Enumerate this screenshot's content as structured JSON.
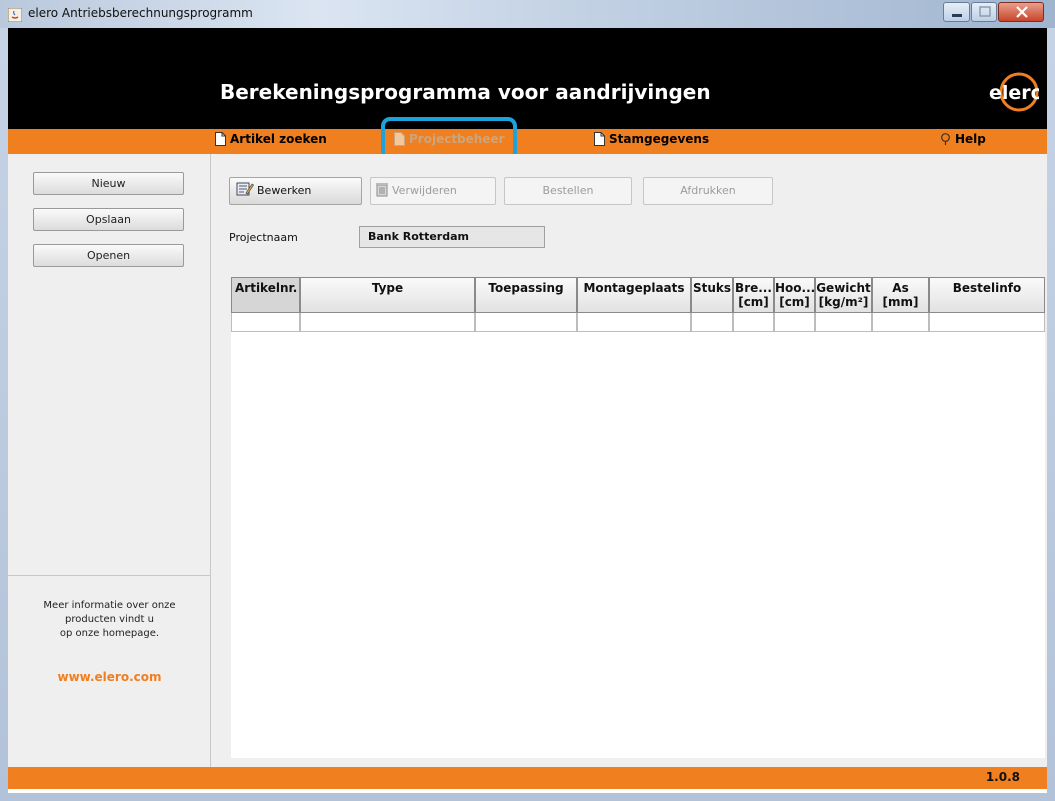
{
  "window": {
    "title": "elero Antriebsberechnungsprogramm"
  },
  "header": {
    "app_title": "Berekeningsprogramma voor aandrijvingen",
    "logo_text": "elero",
    "logo_color": "#f07f1f"
  },
  "nav": {
    "items": [
      {
        "label": "Artikel zoeken",
        "icon": "page-icon",
        "enabled": true
      },
      {
        "label": "Projectbeheer",
        "icon": "page-icon",
        "enabled": false,
        "highlighted": true
      },
      {
        "label": "Stamgegevens",
        "icon": "page-icon",
        "enabled": true
      },
      {
        "label": "Help",
        "icon": "help-icon",
        "enabled": true
      }
    ]
  },
  "sidebar": {
    "buttons": [
      "Nieuw",
      "Opslaan",
      "Openen"
    ],
    "info_lines": [
      "Meer informatie over onze",
      "producten vindt u",
      "op onze homepage."
    ],
    "website": "www.elero.com"
  },
  "toolbar": {
    "buttons": [
      {
        "label": "Bewerken",
        "icon": "edit-icon",
        "enabled": true
      },
      {
        "label": "Verwijderen",
        "icon": "delete-icon",
        "enabled": false
      },
      {
        "label": "Bestellen",
        "enabled": false
      },
      {
        "label": "Afdrukken",
        "enabled": false
      }
    ]
  },
  "project": {
    "label": "Projectnaam",
    "value": "Bank Rotterdam"
  },
  "table": {
    "columns": [
      {
        "line1": "Artikelnr.",
        "line2": ""
      },
      {
        "line1": "Type",
        "line2": ""
      },
      {
        "line1": "Toepassing",
        "line2": ""
      },
      {
        "line1": "Montageplaats",
        "line2": ""
      },
      {
        "line1": "Stuks",
        "line2": ""
      },
      {
        "line1": "Bre...",
        "line2": "[cm]"
      },
      {
        "line1": "Hoo...",
        "line2": "[cm]"
      },
      {
        "line1": "Gewicht",
        "line2": "[kg/m²]"
      },
      {
        "line1": "As",
        "line2": "[mm]"
      },
      {
        "line1": "Bestelinfo",
        "line2": ""
      }
    ],
    "rows": [
      [
        "",
        "",
        "",
        "",
        "",
        "",
        "",
        "",
        "",
        ""
      ]
    ]
  },
  "status": {
    "version": "1.0.8"
  },
  "colors": {
    "accent": "#f07f1f",
    "highlight": "#1ea2db",
    "header_bg": "#000000"
  }
}
